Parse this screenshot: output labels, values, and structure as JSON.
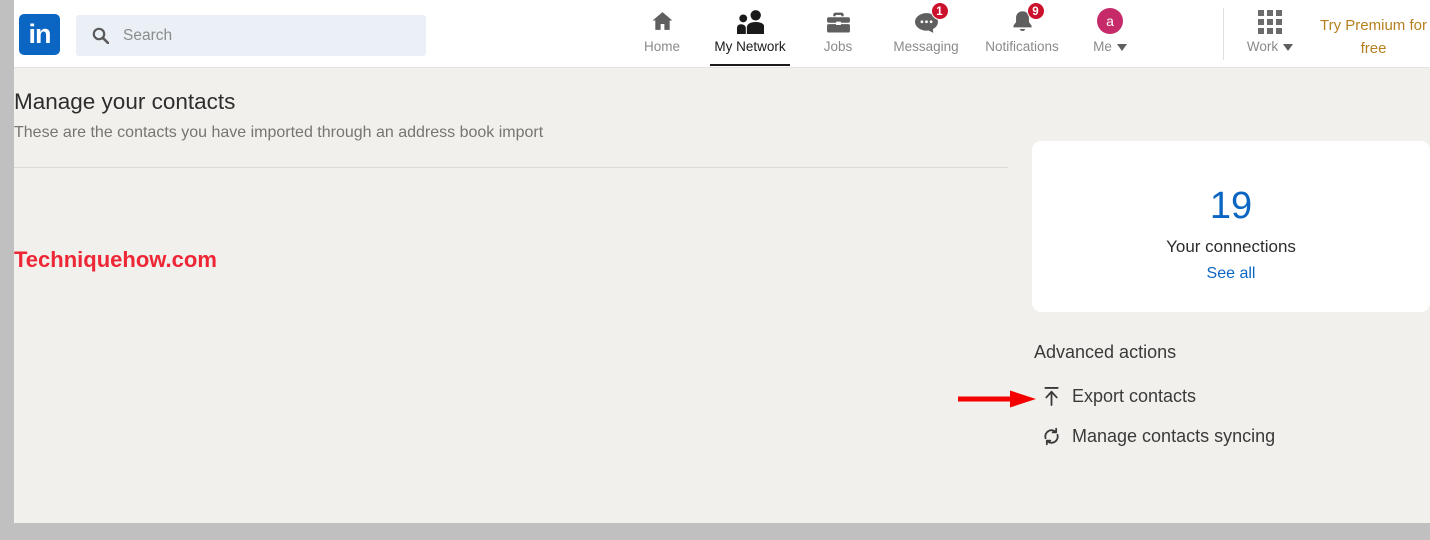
{
  "brand": {
    "logo_text": "in",
    "logo_color": "#0a66c2",
    "premium_color": "#b5811f",
    "accent_blue": "#0a66c2",
    "badge_red": "#cb112d",
    "watermark_red": "#ee2737",
    "avatar_pink": "#c62a68"
  },
  "search": {
    "placeholder": "Search",
    "value": "",
    "icon": "search-icon"
  },
  "nav": {
    "items": [
      {
        "label": "Home",
        "icon": "home-icon",
        "active": false,
        "badge": ""
      },
      {
        "label": "My Network",
        "icon": "my-network-icon",
        "active": true,
        "badge": ""
      },
      {
        "label": "Jobs",
        "icon": "briefcase-icon",
        "active": false,
        "badge": ""
      },
      {
        "label": "Messaging",
        "icon": "message-bubble-icon",
        "active": false,
        "badge": "1"
      },
      {
        "label": "Notifications",
        "icon": "bell-icon",
        "active": false,
        "badge": "9"
      }
    ],
    "me": {
      "label": "Me",
      "avatar_initial": "a",
      "icon": "avatar"
    },
    "work": {
      "label": "Work",
      "icon": "grid-icon"
    },
    "premium": {
      "line1": "Try Premium for",
      "line2": "free"
    }
  },
  "main": {
    "title": "Manage your contacts",
    "subtitle": "These are the contacts you have imported through an address book import",
    "watermark": "Techniquehow.com"
  },
  "connections_card": {
    "count": "19",
    "label": "Your connections",
    "see_all": "See all"
  },
  "advanced": {
    "title": "Advanced actions",
    "actions": [
      {
        "label": "Export contacts",
        "icon": "export-upload-icon"
      },
      {
        "label": "Manage contacts syncing",
        "icon": "sync-refresh-icon"
      }
    ]
  },
  "annotation": {
    "arrow": "red-arrow-pointing-right",
    "color": "#f50000"
  }
}
